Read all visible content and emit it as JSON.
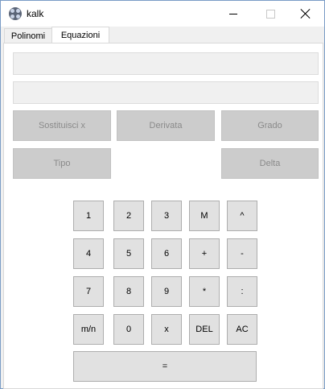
{
  "window": {
    "title": "kalk",
    "app_icon": "kalk-app-icon"
  },
  "tabs": [
    {
      "label": "Polinomi",
      "active": false
    },
    {
      "label": "Equazioni",
      "active": true
    }
  ],
  "inputs": [
    {
      "value": "",
      "placeholder": ""
    },
    {
      "value": "",
      "placeholder": ""
    }
  ],
  "operations": {
    "sostituisci": "Sostituisci x",
    "derivata": "Derivata",
    "grado": "Grado",
    "tipo": "Tipo",
    "delta": "Delta"
  },
  "keypad": {
    "row1": [
      "1",
      "2",
      "3",
      "M",
      "^"
    ],
    "row2": [
      "4",
      "5",
      "6",
      "+",
      "-"
    ],
    "row3": [
      "7",
      "8",
      "9",
      "*",
      ":"
    ],
    "row4": [
      "m/n",
      "0",
      "x",
      "DEL",
      "AC"
    ],
    "equals": "="
  },
  "colors": {
    "disabled_button": "#cccccc",
    "disabled_text": "#8a8a8a",
    "key_background": "#e1e1e1"
  }
}
